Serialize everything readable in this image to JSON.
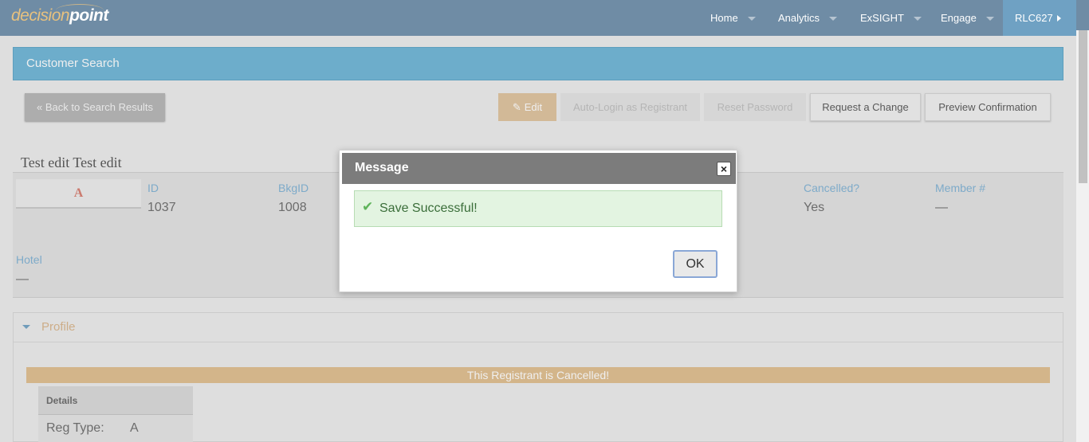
{
  "logo": {
    "part1": "decision",
    "part2": "point"
  },
  "nav": {
    "home": "Home",
    "analytics": "Analytics",
    "exsight": "ExSIGHT",
    "engage": "Engage",
    "user": "RLC627"
  },
  "page": {
    "title": "Customer Search"
  },
  "toolbar": {
    "back_label": "« Back to Search Results",
    "edit_label": "Edit",
    "autologin_label": "Auto-Login as Registrant",
    "reset_label": "Reset Password",
    "request_label": "Request a Change",
    "preview_label": "Preview Confirmation"
  },
  "registrant": {
    "name": "Test edit Test edit",
    "avatar_initial": "A",
    "fields": [
      {
        "label": "ID",
        "value": "1037"
      },
      {
        "label": "BkgID",
        "value": "1008"
      },
      {
        "label": "Cancelled?",
        "value": "Yes"
      },
      {
        "label": "Member #",
        "value": "—"
      },
      {
        "label": "Hotel",
        "value": "—"
      }
    ]
  },
  "profile": {
    "section_title": "Profile",
    "cancel_notice": "This Registrant is Cancelled!",
    "details_title": "Details",
    "reg_type_label": "Reg Type:",
    "reg_type_value": "A"
  },
  "dialog": {
    "title": "Message",
    "close_symbol": "×",
    "check_symbol": "✔",
    "message": "Save Successful!",
    "ok_label": "OK"
  },
  "colors": {
    "topbar": "#6f8ca5",
    "pagebar": "#6bb4d6",
    "accent_orange": "#e0bd8d",
    "label_blue": "#7eb1d4",
    "success_bg": "#e3f4e1"
  }
}
